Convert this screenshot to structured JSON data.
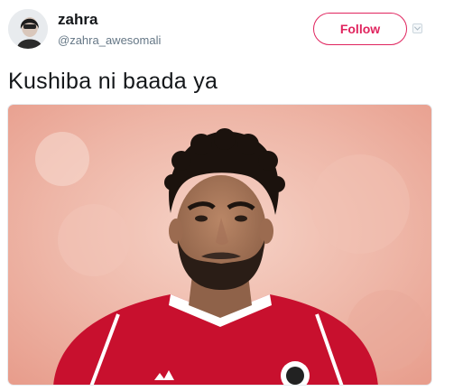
{
  "tweet": {
    "author_name": "zahra",
    "author_handle": "@zahra_awesomali",
    "follow_label": "Follow",
    "text": "Kushiba ni baada ya"
  },
  "icons": {
    "avatar": "avatar",
    "menu": "chevron-down-icon"
  },
  "colors": {
    "accent": "#e0245e",
    "text": "#14171a",
    "secondary_text": "#657786",
    "jersey": "#c8102e"
  }
}
